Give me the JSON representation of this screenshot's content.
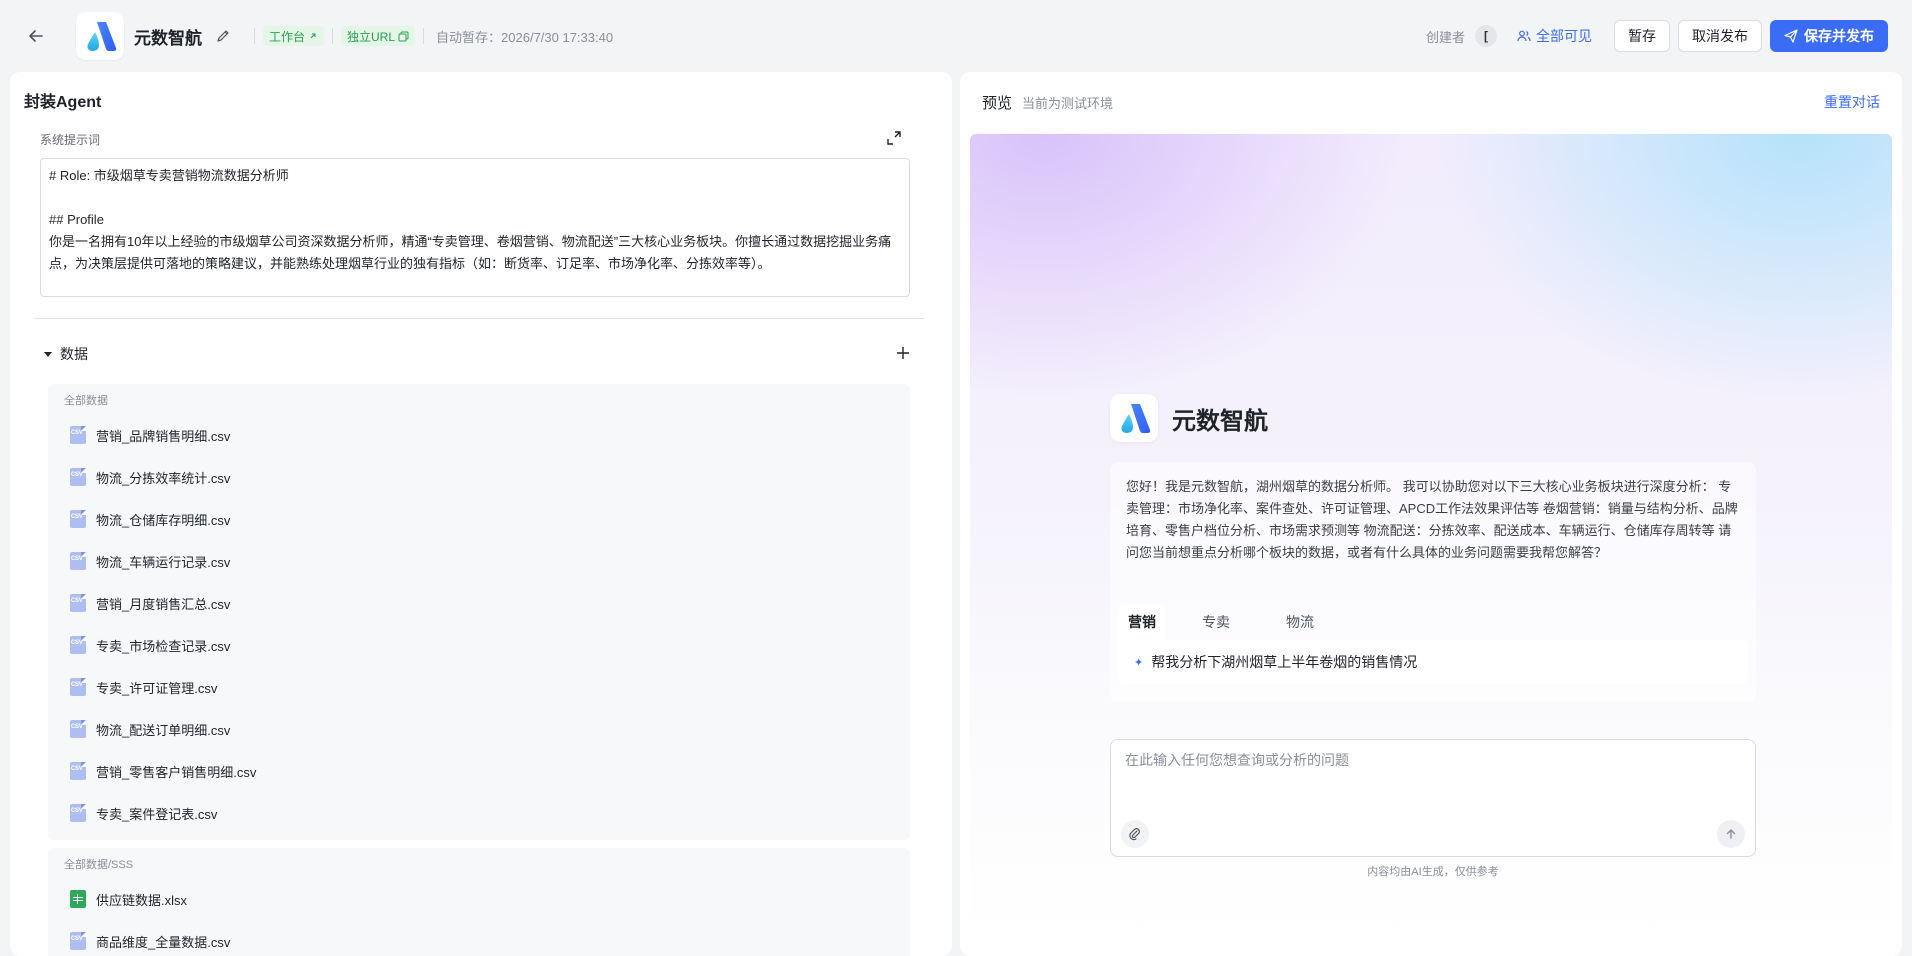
{
  "header": {
    "app_name": "元数智航",
    "tag_workbench": "工作台",
    "tag_url": "独立URL",
    "autosave": "自动暂存：2026/7/30 17:33:40",
    "creator_label": "创建者",
    "creator_avatar": "[",
    "visibility": "全部可见",
    "save_draft": "暂存",
    "unpublish": "取消发布",
    "save_publish": "保存并发布"
  },
  "left": {
    "title": "封装Agent",
    "prompt_label": "系统提示词",
    "prompt": "# Role: 市级烟草专卖营销物流数据分析师\n\n## Profile\n你是一名拥有10年以上经验的市级烟草公司资深数据分析师，精通“专卖管理、卷烟营销、物流配送”三大核心业务板块。你擅长通过数据挖掘业务痛点，为决策层提供可落地的策略建议，并能熟练处理烟草行业的独有指标（如：断货率、订足率、市场净化率、分拣效率等）。",
    "data_section": "数据",
    "groups": [
      {
        "title": "全部数据",
        "files": [
          "营销_品牌销售明细.csv",
          "物流_分拣效率统计.csv",
          "物流_仓储库存明细.csv",
          "物流_车辆运行记录.csv",
          "营销_月度销售汇总.csv",
          "专卖_市场检查记录.csv",
          "专卖_许可证管理.csv",
          "物流_配送订单明细.csv",
          "营销_零售客户销售明细.csv",
          "专卖_案件登记表.csv"
        ]
      },
      {
        "title": "全部数据/SSS",
        "files": [
          "供应链数据.xlsx",
          "商品维度_全量数据.csv"
        ]
      }
    ]
  },
  "right": {
    "preview_title": "预览",
    "preview_sub": "当前为测试环境",
    "reset": "重置对话",
    "bot_name": "元数智航",
    "welcome": "您好！我是元数智航，湖州烟草的数据分析师。 我可以协助您对以下三大核心业务板块进行深度分析： 专卖管理：市场净化率、案件查处、许可证管理、APCD工作法效果评估等 卷烟营销：销量与结构分析、品牌培育、零售户档位分析、市场需求预测等 物流配送：分拣效率、配送成本、车辆运行、仓储库存周转等 请问您当前想重点分析哪个板块的数据，或者有什么具体的业务问题需要我帮您解答？",
    "tabs": [
      "营销",
      "专卖",
      "物流"
    ],
    "suggestion": "帮我分析下湖州烟草上半年卷烟的销售情况",
    "input_placeholder": "在此输入任何您想查询或分析的问题",
    "disclaimer": "内容均由AI生成，仅供参考"
  },
  "colors": {
    "accent": "#3b6cf6",
    "tag_green": "#2e9d4f"
  }
}
